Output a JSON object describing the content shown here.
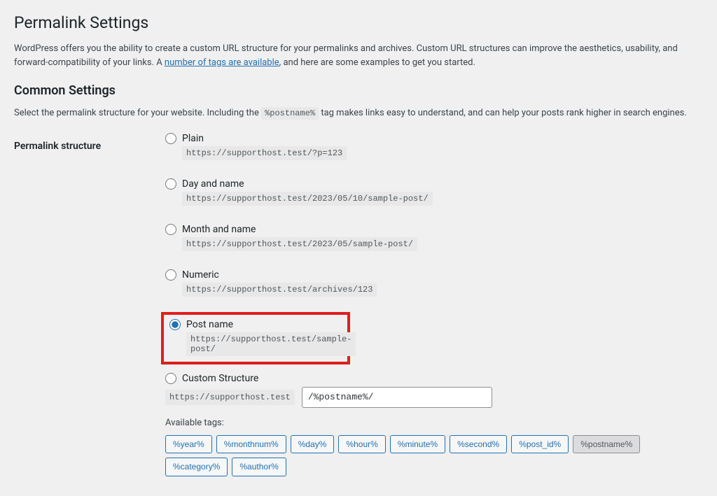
{
  "page": {
    "title": "Permalink Settings",
    "intro_before_link": "WordPress offers you the ability to create a custom URL structure for your permalinks and archives. Custom URL structures can improve the aesthetics, usability, and forward-compatibility of your links. A ",
    "intro_link": "number of tags are available",
    "intro_after_link": ", and here are some examples to get you started."
  },
  "common": {
    "heading": "Common Settings",
    "help_before": "Select the permalink structure for your website. Including the ",
    "help_code": "%postname%",
    "help_after": " tag makes links easy to understand, and can help your posts rank higher in search engines.",
    "field_label": "Permalink structure"
  },
  "options": {
    "plain": {
      "label": "Plain",
      "example": "https://supporthost.test/?p=123"
    },
    "day_name": {
      "label": "Day and name",
      "example": "https://supporthost.test/2023/05/10/sample-post/"
    },
    "month_name": {
      "label": "Month and name",
      "example": "https://supporthost.test/2023/05/sample-post/"
    },
    "numeric": {
      "label": "Numeric",
      "example": "https://supporthost.test/archives/123"
    },
    "post_name": {
      "label": "Post name",
      "example": "https://supporthost.test/sample-post/"
    },
    "custom": {
      "label": "Custom Structure",
      "prefix": "https://supporthost.test",
      "value": "/%postname%/"
    }
  },
  "tags": {
    "label": "Available tags:",
    "items": [
      "%year%",
      "%monthnum%",
      "%day%",
      "%hour%",
      "%minute%",
      "%second%",
      "%post_id%",
      "%postname%",
      "%category%",
      "%author%"
    ]
  }
}
